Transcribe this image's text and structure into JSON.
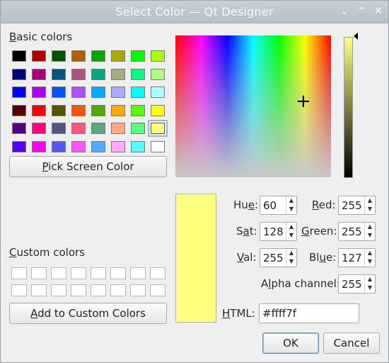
{
  "window": {
    "title": "Select Color — Qt Designer"
  },
  "titlebar_buttons": [
    {
      "name": "chevron-down-icon",
      "glyph": "⌄"
    },
    {
      "name": "chevron-up-icon",
      "glyph": "⌃"
    },
    {
      "name": "close-icon",
      "glyph": "✕"
    }
  ],
  "basic_colors": {
    "label_first": "B",
    "label_rest": "asic colors",
    "rows": [
      [
        "#000000",
        "#b00000",
        "#005400",
        "#b35f00",
        "#00aa00",
        "#aaaa00",
        "#00ff00",
        "#aaff00"
      ],
      [
        "#00007f",
        "#aa007f",
        "#00557f",
        "#aa557f",
        "#00aa7f",
        "#aaaa7f",
        "#00ff7f",
        "#aaff7f"
      ],
      [
        "#0000ff",
        "#aa00ff",
        "#0055ff",
        "#aa55ff",
        "#00aaff",
        "#aaaaff",
        "#00ffff",
        "#aaffff"
      ],
      [
        "#550000",
        "#ff0000",
        "#555500",
        "#ff5500",
        "#55aa00",
        "#ffaa00",
        "#55ff00",
        "#ffff00"
      ],
      [
        "#55007f",
        "#ff007f",
        "#55557f",
        "#ff557f",
        "#55aa7f",
        "#ffaa7f",
        "#55ff7f",
        "#ffff7f"
      ],
      [
        "#5500ff",
        "#ff00ff",
        "#5555ff",
        "#ff55ff",
        "#55aaff",
        "#ffaaff",
        "#55ffff",
        "#ffffff"
      ]
    ],
    "selected_row": 4,
    "selected_col": 7
  },
  "pick_screen_button": {
    "first": "P",
    "rest": "ick Screen Color"
  },
  "custom_colors": {
    "label_first": "C",
    "label_rest": "ustom colors",
    "count": 16
  },
  "add_custom_button": {
    "first": "A",
    "rest": "dd to Custom Colors"
  },
  "current_color": "#ffff7f",
  "fields": {
    "hue": {
      "label_pre": "Hu",
      "label_u": "e",
      "label_post": ":",
      "value": "60"
    },
    "sat": {
      "label_pre": "S",
      "label_u": "a",
      "label_post": "t:",
      "value": "128"
    },
    "val": {
      "label_pre": "",
      "label_u": "V",
      "label_post": "al:",
      "value": "255"
    },
    "red": {
      "label_pre": "",
      "label_u": "R",
      "label_post": "ed:",
      "value": "255"
    },
    "green": {
      "label_pre": "",
      "label_u": "G",
      "label_post": "reen:",
      "value": "255"
    },
    "blue": {
      "label_pre": "Bl",
      "label_u": "u",
      "label_post": "e:",
      "value": "127"
    },
    "alpha": {
      "label_pre": "A",
      "label_u": "l",
      "label_post": "pha channel:",
      "value": "255"
    }
  },
  "html_field": {
    "label_u": "H",
    "label_rest": "TML:",
    "value": "#ffff7f"
  },
  "ok_button": "OK",
  "cancel_button": "Cancel",
  "spin_up_glyph": "▲",
  "spin_down_glyph": "▼",
  "crosshair_glyph": "+"
}
